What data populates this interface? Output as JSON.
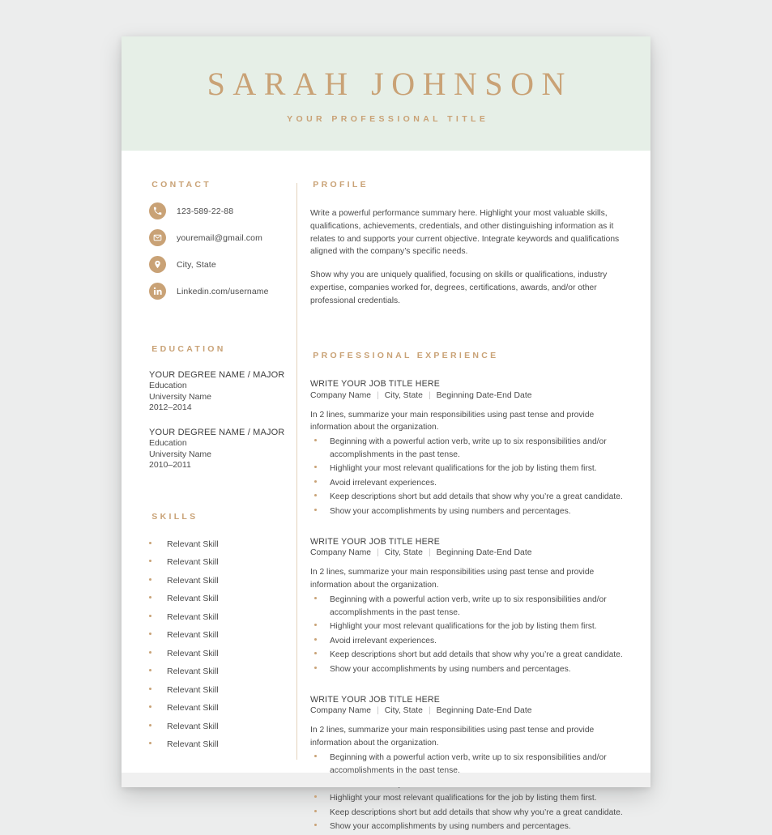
{
  "header": {
    "name": "SARAH JOHNSON",
    "title": "YOUR PROFESSIONAL TITLE"
  },
  "colors": {
    "accent": "#c9a276",
    "header_background": "#e6efe7",
    "page_background": "#ffffff",
    "canvas_background": "#eceded",
    "body_text": "#4b4b4b",
    "divider": "#e3d3bd"
  },
  "sidebar": {
    "contact": {
      "heading": "CONTACT",
      "items": [
        {
          "icon": "phone-icon",
          "text": "123-589-22-88"
        },
        {
          "icon": "envelope-icon",
          "text": "youremail@gmail.com"
        },
        {
          "icon": "map-pin-icon",
          "text": "City, State"
        },
        {
          "icon": "linkedin-icon",
          "text": "Linkedin.com/username"
        }
      ]
    },
    "education": {
      "heading": "EDUCATION",
      "entries": [
        {
          "degree": "YOUR DEGREE NAME / MAJOR",
          "level": "Education",
          "school": "University Name",
          "dates": "2012–2014"
        },
        {
          "degree": "YOUR DEGREE NAME / MAJOR",
          "level": "Education",
          "school": "University Name",
          "dates": "2010–2011"
        }
      ]
    },
    "skills": {
      "heading": "SKILLS",
      "items": [
        "Relevant Skill",
        "Relevant Skill",
        "Relevant Skill",
        "Relevant Skill",
        "Relevant Skill",
        "Relevant Skill",
        "Relevant Skill",
        "Relevant Skill",
        "Relevant Skill",
        "Relevant Skill",
        "Relevant Skill",
        "Relevant Skill"
      ]
    }
  },
  "main": {
    "profile": {
      "heading": "PROFILE",
      "paragraphs": [
        "Write a powerful performance summary here. Highlight your most valuable skills, qualifications, achievements, credentials, and other distinguishing information as it relates to and supports your current objective. Integrate keywords and qualifications aligned with the company’s specific needs.",
        "Show why you are uniquely qualified, focusing on skills or qualifications, industry expertise, companies worked for, degrees, certifications, awards, and/or other professional credentials."
      ]
    },
    "experience": {
      "heading": "PROFESSIONAL EXPERIENCE",
      "jobs": [
        {
          "title": "WRITE YOUR JOB TITLE HERE",
          "company": "Company Name",
          "location": "City, State",
          "dates": "Beginning Date-End Date",
          "summary": "In 2 lines, summarize your main responsibilities using past tense and provide information about the organization.",
          "bullets": [
            "Beginning with a powerful action verb, write up to six responsibilities and/or accomplishments in the past tense.",
            "Highlight your most relevant qualifications for the job by listing them first.",
            "Avoid irrelevant experiences.",
            "Keep descriptions short but add details that show why you’re a great candidate.",
            "Show your accomplishments by using numbers and percentages."
          ]
        },
        {
          "title": "WRITE YOUR JOB TITLE HERE",
          "company": "Company Name",
          "location": "City, State",
          "dates": "Beginning Date-End Date",
          "summary": "In 2 lines, summarize your main responsibilities using past tense and provide information about the organization.",
          "bullets": [
            "Beginning with a powerful action verb, write up to six responsibilities and/or accomplishments in the past tense.",
            "Highlight your most relevant qualifications for the job by listing them first.",
            "Avoid irrelevant experiences.",
            "Keep descriptions short but add details that show why you’re a great candidate.",
            "Show your accomplishments by using numbers and percentages."
          ]
        },
        {
          "title": "WRITE YOUR JOB TITLE HERE",
          "company": "Company Name",
          "location": "City, State",
          "dates": "Beginning Date-End Date",
          "summary": "In 2 lines, summarize your main responsibilities using past tense and provide information about the organization.",
          "bullets": [
            "Beginning with a powerful action verb, write up to six responsibilities and/or accomplishments in the past tense.",
            "Avoid irrelevant experiences.",
            "Highlight your most relevant qualifications for the job by listing them first.",
            "Keep descriptions short but add details that show why you’re a great candidate.",
            "Show your accomplishments by using numbers and percentages."
          ]
        }
      ]
    }
  }
}
